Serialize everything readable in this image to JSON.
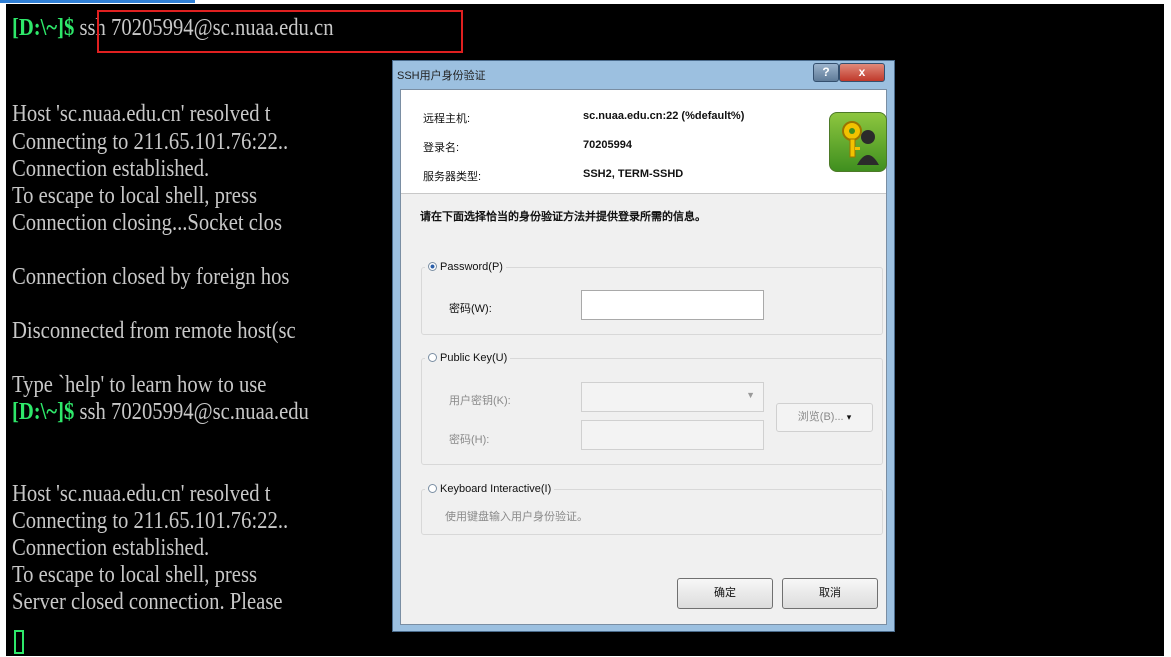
{
  "terminal": {
    "prompt": "[D:\\~]$",
    "first_command": " ssh 70205994@sc.nuaa.edu.cn",
    "lines": [
      "Host 'sc.nuaa.edu.cn' resolved t",
      "Connecting to 211.65.101.76:22..",
      "Connection established.",
      "To escape to local shell, press",
      "Connection closing...Socket clos",
      "",
      "Connection closed by foreign hos",
      "",
      "Disconnected from remote host(sc",
      "",
      "Type `help' to learn how to use",
      "",
      "",
      "",
      "Host 'sc.nuaa.edu.cn' resolved t",
      "Connecting to 211.65.101.76:22..",
      "Connection established.",
      "To escape to local shell, press",
      "Server closed connection. Please"
    ],
    "second_prompt": "[D:\\~]$",
    "second_command": " ssh 70205994@sc.nuaa.edu"
  },
  "dialog": {
    "title": "SSH用户身份验证",
    "help_label": "?",
    "close_label": "x",
    "remote_host_label": "远程主机:",
    "remote_host_value": "sc.nuaa.edu.cn:22 (%default%)",
    "login_label": "登录名:",
    "login_value": "70205994",
    "server_type_label": "服务器类型:",
    "server_type_value": "SSH2, TERM-SSHD",
    "instruction": "请在下面选择恰当的身份验证方法并提供登录所需的信息。",
    "password_option": "Password(P)",
    "password_field_label": "密码(W):",
    "password_value": "",
    "pubkey_option": "Public Key(U)",
    "user_key_label": "用户密钥(K):",
    "browse_label": "浏览(B)...",
    "passphrase_label": "密码(H):",
    "keyboard_option": "Keyboard Interactive(I)",
    "keyboard_desc": "使用键盘输入用户身份验证。",
    "ok_label": "确定",
    "cancel_label": "取消"
  }
}
